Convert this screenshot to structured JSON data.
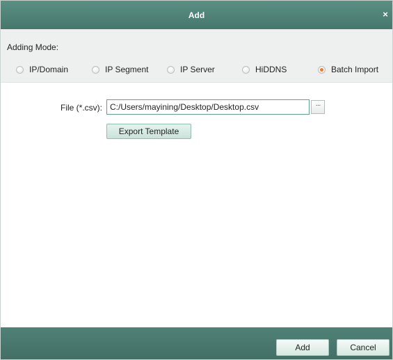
{
  "window": {
    "title": "Add",
    "close_glyph": "×"
  },
  "adding_mode": {
    "label": "Adding Mode:",
    "options": [
      {
        "label": "IP/Domain",
        "selected": false
      },
      {
        "label": "IP Segment",
        "selected": false
      },
      {
        "label": "IP Server",
        "selected": false
      },
      {
        "label": "HiDDNS",
        "selected": false
      },
      {
        "label": "Batch Import",
        "selected": true
      }
    ]
  },
  "batch_import": {
    "file_label": "File (*.csv):",
    "file_value": "C:/Users/mayining/Desktop/Desktop.csv",
    "browse_label": "···",
    "export_template_label": "Export Template"
  },
  "footer": {
    "add_label": "Add",
    "cancel_label": "Cancel"
  },
  "colors": {
    "title_bar": "#4f8177",
    "radio_selected": "#f07a2a",
    "input_border": "#5fa08a"
  },
  "icons": {
    "close": "close-icon",
    "browse": "ellipsis-icon"
  }
}
